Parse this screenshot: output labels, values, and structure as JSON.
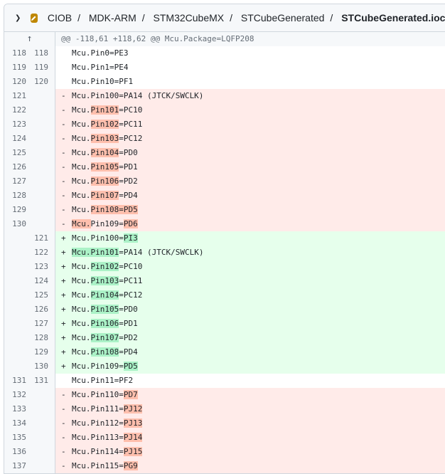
{
  "header": {
    "breadcrumb": [
      "CIOB",
      "MDK-ARM",
      "STM32CubeMX",
      "STCubeGenerated"
    ],
    "file_name": "STCubeGenerated.ioc"
  },
  "hunk": "@@ -118,61 +118,62 @@ Mcu.Package=LQFP208",
  "colors": {
    "deletion_bg": "#ffebe9",
    "addition_bg": "#e6ffec",
    "deletion_highlight": "#ffbfad",
    "addition_highlight": "#abf2c7"
  },
  "lines": [
    {
      "old": "118",
      "new": "118",
      "type": "ctx",
      "segs": [
        [
          "Mcu.Pin0=PE3",
          0
        ]
      ]
    },
    {
      "old": "119",
      "new": "119",
      "type": "ctx",
      "segs": [
        [
          "Mcu.Pin1=PE4",
          0
        ]
      ]
    },
    {
      "old": "120",
      "new": "120",
      "type": "ctx",
      "segs": [
        [
          "Mcu.Pin10=PF1",
          0
        ]
      ]
    },
    {
      "old": "121",
      "new": "",
      "type": "del",
      "segs": [
        [
          "Mcu.Pin100=PA14 (JTCK/SWCLK)",
          0
        ]
      ]
    },
    {
      "old": "122",
      "new": "",
      "type": "del",
      "segs": [
        [
          "Mcu.",
          0
        ],
        [
          "Pin101",
          1
        ],
        [
          "=PC10",
          0
        ]
      ]
    },
    {
      "old": "123",
      "new": "",
      "type": "del",
      "segs": [
        [
          "Mcu.",
          0
        ],
        [
          "Pin102",
          1
        ],
        [
          "=PC11",
          0
        ]
      ]
    },
    {
      "old": "124",
      "new": "",
      "type": "del",
      "segs": [
        [
          "Mcu.",
          0
        ],
        [
          "Pin103",
          1
        ],
        [
          "=PC12",
          0
        ]
      ]
    },
    {
      "old": "125",
      "new": "",
      "type": "del",
      "segs": [
        [
          "Mcu.",
          0
        ],
        [
          "Pin104",
          1
        ],
        [
          "=PD0",
          0
        ]
      ]
    },
    {
      "old": "126",
      "new": "",
      "type": "del",
      "segs": [
        [
          "Mcu.",
          0
        ],
        [
          "Pin105",
          1
        ],
        [
          "=PD1",
          0
        ]
      ]
    },
    {
      "old": "127",
      "new": "",
      "type": "del",
      "segs": [
        [
          "Mcu.",
          0
        ],
        [
          "Pin106",
          1
        ],
        [
          "=PD2",
          0
        ]
      ]
    },
    {
      "old": "128",
      "new": "",
      "type": "del",
      "segs": [
        [
          "Mcu.",
          0
        ],
        [
          "Pin107",
          1
        ],
        [
          "=PD4",
          0
        ]
      ]
    },
    {
      "old": "129",
      "new": "",
      "type": "del",
      "segs": [
        [
          "Mcu.",
          0
        ],
        [
          "Pin108=PD5",
          1
        ]
      ]
    },
    {
      "old": "130",
      "new": "",
      "type": "del",
      "segs": [
        [
          "Mcu.",
          1
        ],
        [
          "Pin109=",
          0
        ],
        [
          "PD6",
          1
        ]
      ]
    },
    {
      "old": "",
      "new": "121",
      "type": "add",
      "segs": [
        [
          "Mcu.Pin100=",
          0
        ],
        [
          "PI3",
          1
        ]
      ]
    },
    {
      "old": "",
      "new": "122",
      "type": "add",
      "segs": [
        [
          "Mcu.Pin101",
          1
        ],
        [
          "=PA14 (JTCK/SWCLK)",
          0
        ]
      ]
    },
    {
      "old": "",
      "new": "123",
      "type": "add",
      "segs": [
        [
          "Mcu.",
          0
        ],
        [
          "Pin102",
          1
        ],
        [
          "=PC10",
          0
        ]
      ]
    },
    {
      "old": "",
      "new": "124",
      "type": "add",
      "segs": [
        [
          "Mcu.",
          0
        ],
        [
          "Pin103",
          1
        ],
        [
          "=PC11",
          0
        ]
      ]
    },
    {
      "old": "",
      "new": "125",
      "type": "add",
      "segs": [
        [
          "Mcu.",
          0
        ],
        [
          "Pin104",
          1
        ],
        [
          "=PC12",
          0
        ]
      ]
    },
    {
      "old": "",
      "new": "126",
      "type": "add",
      "segs": [
        [
          "Mcu.",
          0
        ],
        [
          "Pin105",
          1
        ],
        [
          "=PD0",
          0
        ]
      ]
    },
    {
      "old": "",
      "new": "127",
      "type": "add",
      "segs": [
        [
          "Mcu.",
          0
        ],
        [
          "Pin106",
          1
        ],
        [
          "=PD1",
          0
        ]
      ]
    },
    {
      "old": "",
      "new": "128",
      "type": "add",
      "segs": [
        [
          "Mcu.",
          0
        ],
        [
          "Pin107",
          1
        ],
        [
          "=PD2",
          0
        ]
      ]
    },
    {
      "old": "",
      "new": "129",
      "type": "add",
      "segs": [
        [
          "Mcu.",
          0
        ],
        [
          "Pin108",
          1
        ],
        [
          "=PD4",
          0
        ]
      ]
    },
    {
      "old": "",
      "new": "130",
      "type": "add",
      "segs": [
        [
          "Mcu.Pin109=",
          0
        ],
        [
          "PD5",
          1
        ]
      ]
    },
    {
      "old": "131",
      "new": "131",
      "type": "ctx",
      "segs": [
        [
          "Mcu.Pin11=PF2",
          0
        ]
      ]
    },
    {
      "old": "132",
      "new": "",
      "type": "del",
      "segs": [
        [
          "Mcu.Pin110=",
          0
        ],
        [
          "PD7",
          1
        ]
      ]
    },
    {
      "old": "133",
      "new": "",
      "type": "del",
      "segs": [
        [
          "Mcu.Pin111=",
          0
        ],
        [
          "PJ12",
          1
        ]
      ]
    },
    {
      "old": "134",
      "new": "",
      "type": "del",
      "segs": [
        [
          "Mcu.Pin112=",
          0
        ],
        [
          "PJ13",
          1
        ]
      ]
    },
    {
      "old": "135",
      "new": "",
      "type": "del",
      "segs": [
        [
          "Mcu.Pin113=",
          0
        ],
        [
          "PJ14",
          1
        ]
      ]
    },
    {
      "old": "136",
      "new": "",
      "type": "del",
      "segs": [
        [
          "Mcu.Pin114=",
          0
        ],
        [
          "PJ15",
          1
        ]
      ]
    },
    {
      "old": "137",
      "new": "",
      "type": "del",
      "segs": [
        [
          "Mcu.Pin115=",
          0
        ],
        [
          "PG9",
          1
        ]
      ]
    }
  ]
}
